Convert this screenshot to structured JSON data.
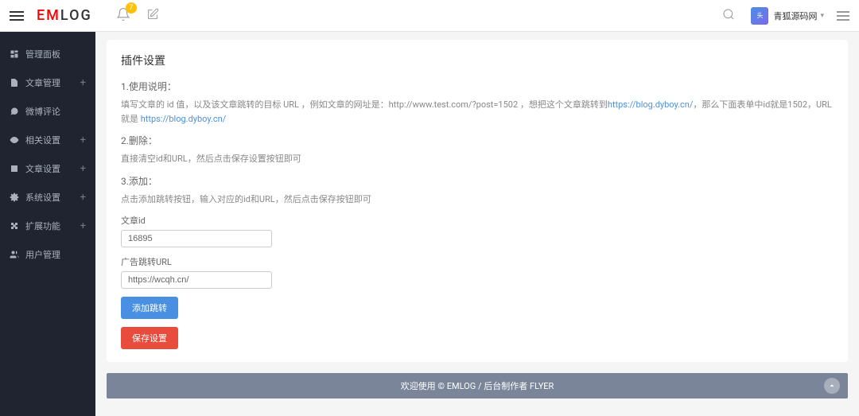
{
  "header": {
    "logo_em": "EM",
    "logo_log": "LOG",
    "notif_count": "7",
    "username": "青狐源码网"
  },
  "sidebar": {
    "items": [
      {
        "label": "管理面板",
        "icon": "dashboard",
        "expandable": false
      },
      {
        "label": "文章管理",
        "icon": "file",
        "expandable": true
      },
      {
        "label": "微博评论",
        "icon": "chat",
        "expandable": false
      },
      {
        "label": "相关设置",
        "icon": "eye",
        "expandable": true
      },
      {
        "label": "文章设置",
        "icon": "doc",
        "expandable": true
      },
      {
        "label": "系统设置",
        "icon": "gear",
        "expandable": true
      },
      {
        "label": "扩展功能",
        "icon": "puzzle",
        "expandable": true
      },
      {
        "label": "用户管理",
        "icon": "users",
        "expandable": false
      }
    ]
  },
  "content": {
    "title": "插件设置",
    "section1_label": "1.使用说明：",
    "section1_desc_a": "填写文章的 id 值，以及该文章跳转的目标 URL ，例如文章的网址是：http://www.test.com/?post=1502 ，想把这个文章跳转到",
    "section1_link1": "https://blog.dyboy.cn/",
    "section1_desc_b": "，那么下面表单中id就是1502，URL就是 ",
    "section1_link2": "https://blog.dyboy.cn/",
    "section2_label": "2.删除：",
    "section2_desc": "直接清空id和URL，然后点击保存设置按钮即可",
    "section3_label": "3.添加：",
    "section3_desc": "点击添加跳转按钮，输入对应的id和URL，然后点击保存按钮即可",
    "field1_label": "文章id",
    "field1_value": "16895",
    "field2_label": "广告跳转URL",
    "field2_value": "https://wcqh.cn/",
    "btn_add": "添加跳转",
    "btn_save": "保存设置"
  },
  "footer": {
    "text": "欢迎使用 © EMLOG / 后台制作者 FLYER"
  }
}
